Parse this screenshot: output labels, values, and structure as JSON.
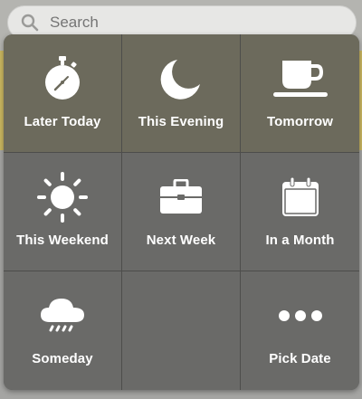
{
  "search": {
    "placeholder": "Search",
    "icon": "search-icon"
  },
  "colors": {
    "accent_strip": "#c9b661",
    "panel": "#6a6a68",
    "text": "#ffffff"
  },
  "snooze_options": [
    {
      "label": "Later Today",
      "icon": "stopwatch-icon"
    },
    {
      "label": "This Evening",
      "icon": "moon-icon"
    },
    {
      "label": "Tomorrow",
      "icon": "coffee-cup-icon"
    },
    {
      "label": "This Weekend",
      "icon": "sun-icon"
    },
    {
      "label": "Next Week",
      "icon": "briefcase-icon"
    },
    {
      "label": "In a Month",
      "icon": "calendar-icon"
    },
    {
      "label": "Someday",
      "icon": "rain-cloud-icon"
    },
    {
      "label": "",
      "icon": ""
    },
    {
      "label": "Pick Date",
      "icon": "more-dots-icon"
    }
  ]
}
